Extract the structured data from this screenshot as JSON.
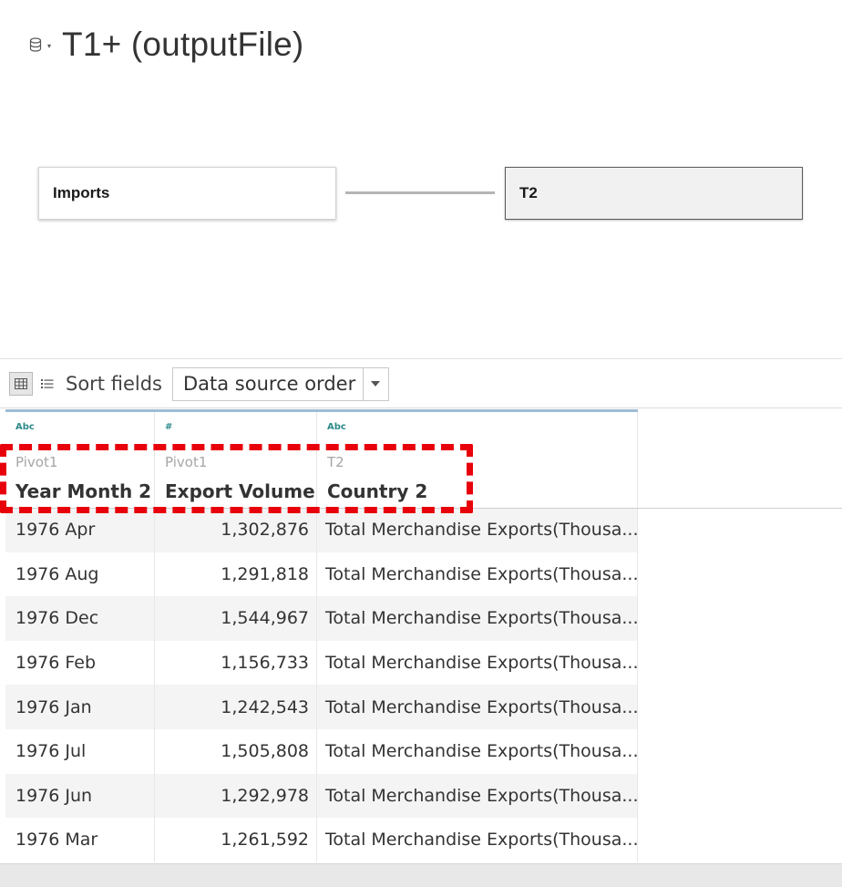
{
  "header": {
    "title": "T1+ (outputFile)",
    "icon": "database-icon",
    "caret": "▾"
  },
  "join": {
    "left_table": "Imports",
    "right_table": "T2"
  },
  "toolbar": {
    "sort_label": "Sort fields",
    "sort_value": "Data source order",
    "grid_icon": "grid-view-icon",
    "list_icon": "list-view-icon"
  },
  "columns": [
    {
      "type": "Abc",
      "source": "Pivot1",
      "name": "Year Month 2"
    },
    {
      "type": "#",
      "source": "Pivot1",
      "name": "Export Volume"
    },
    {
      "type": "Abc",
      "source": "T2",
      "name": "Country 2"
    }
  ],
  "rows": [
    [
      "1976 Apr",
      "1,302,876",
      "Total Merchandise Exports(Thousa..."
    ],
    [
      "1976 Aug",
      "1,291,818",
      "Total Merchandise Exports(Thousa..."
    ],
    [
      "1976 Dec",
      "1,544,967",
      "Total Merchandise Exports(Thousa..."
    ],
    [
      "1976 Feb",
      "1,156,733",
      "Total Merchandise Exports(Thousa..."
    ],
    [
      "1976 Jan",
      "1,242,543",
      "Total Merchandise Exports(Thousa..."
    ],
    [
      "1976 Jul",
      "1,505,808",
      "Total Merchandise Exports(Thousa..."
    ],
    [
      "1976 Jun",
      "1,292,978",
      "Total Merchandise Exports(Thousa..."
    ],
    [
      "1976 Mar",
      "1,261,592",
      "Total Merchandise Exports(Thousa..."
    ]
  ],
  "colors": {
    "highlight": "#e8000b",
    "type_text": "#2e8b8b",
    "header_accent": "#9fbcd6"
  }
}
